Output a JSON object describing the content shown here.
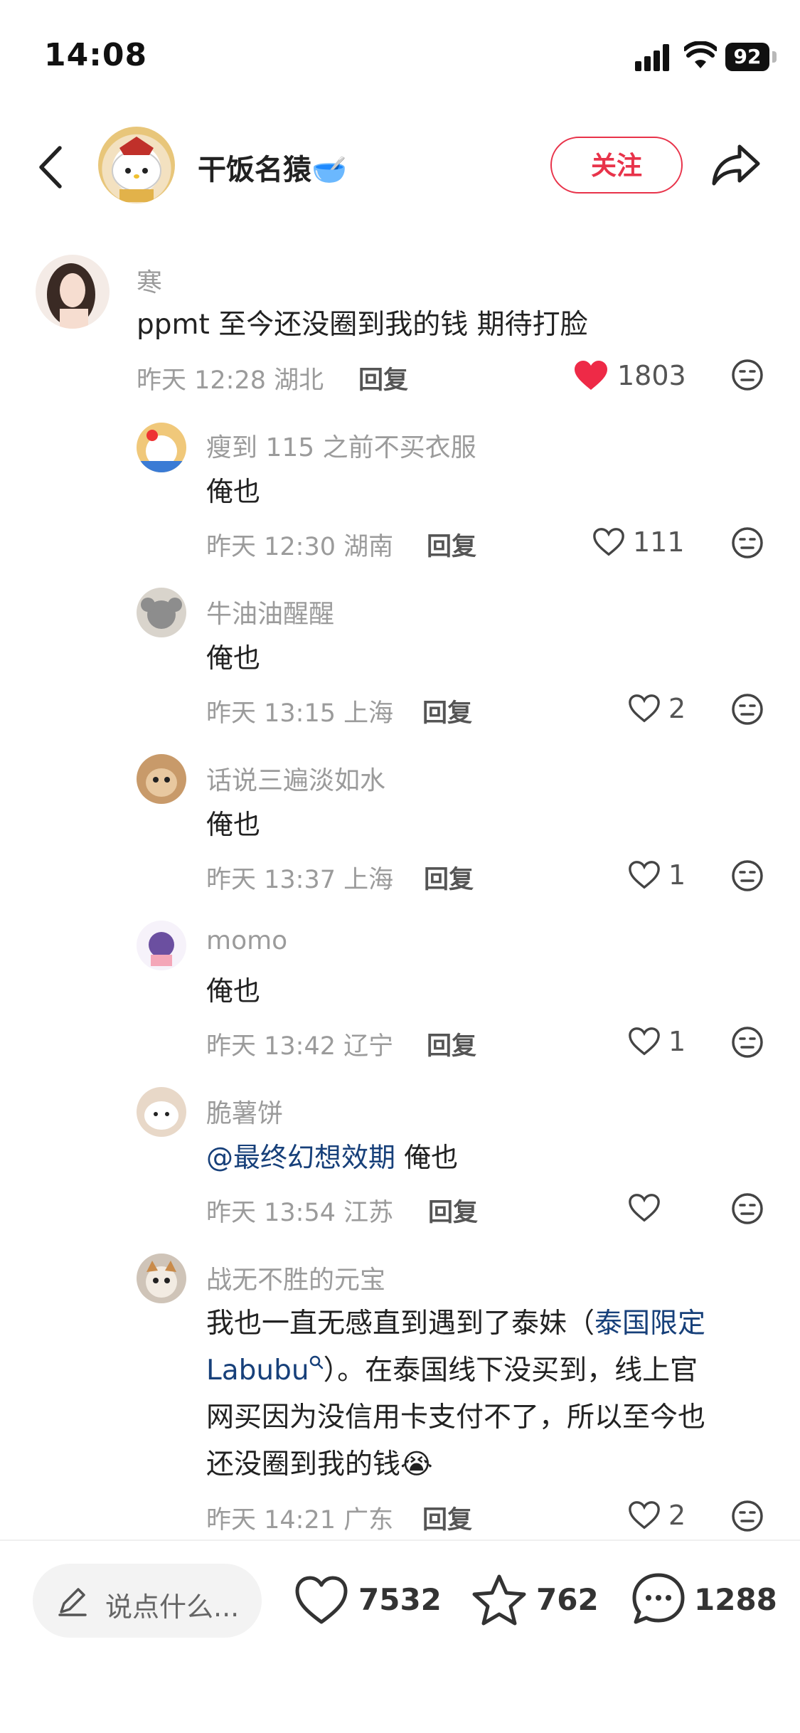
{
  "status_bar": {
    "time": "14:08",
    "battery": "92"
  },
  "header": {
    "author": "干饭名猿",
    "author_emoji": "🥣",
    "follow_label": "关注"
  },
  "top_comment": {
    "username": "寒",
    "text": "ppmt 至今还没圈到我的钱 期待打脸",
    "time": "昨天 12:28",
    "location": "湖北",
    "reply_label": "回复",
    "likes": "1803",
    "liked": true
  },
  "replies": [
    {
      "username": "瘦到 115 之前不买衣服",
      "text": "俺也",
      "time": "昨天 12:30",
      "location": "湖南",
      "reply_label": "回复",
      "likes": "111"
    },
    {
      "username": "牛油油醒醒",
      "text": "俺也",
      "time": "昨天 13:15",
      "location": "上海",
      "reply_label": "回复",
      "likes": "2"
    },
    {
      "username": "话说三遍淡如水",
      "text": "俺也",
      "time": "昨天 13:37",
      "location": "上海",
      "reply_label": "回复",
      "likes": "1"
    },
    {
      "username": "momo",
      "text": "俺也",
      "time": "昨天 13:42",
      "location": "辽宁",
      "reply_label": "回复",
      "likes": "1"
    },
    {
      "username": "脆薯饼",
      "mention": "@最终幻想效期",
      "text": " 俺也",
      "time": "昨天 13:54",
      "location": "江苏",
      "reply_label": "回复",
      "likes": ""
    },
    {
      "username": "战无不胜的元宝",
      "text_lines": [
        "我也一直无感直到遇到了泰妹（",
        "）。在泰国线下没买到，线上官",
        "网买因为没信用卡支付不了，所以至今也",
        "还没圈到我的钱"
      ],
      "link_1": "泰国限定",
      "link_2": "Labubu",
      "emoji": "😭",
      "time": "昨天 14:21",
      "location": "广东",
      "reply_label": "回复",
      "likes": "2"
    }
  ],
  "bottom_bar": {
    "input_placeholder": "说点什么...",
    "likes": "7532",
    "favorites": "762",
    "comments": "1288"
  },
  "colors": {
    "accent": "#e8334a",
    "link": "#17407a",
    "meta": "#9b9b9b"
  }
}
